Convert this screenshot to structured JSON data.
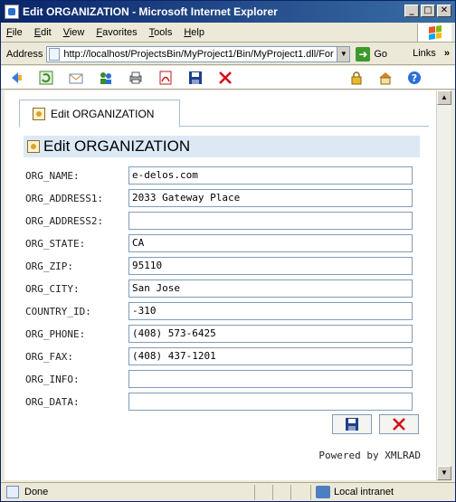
{
  "window": {
    "title": "Edit ORGANIZATION - Microsoft Internet Explorer",
    "minimize_glyph": "_",
    "maximize_glyph": "□",
    "close_glyph": "✕"
  },
  "menu": {
    "items": [
      "File",
      "Edit",
      "View",
      "Favorites",
      "Tools",
      "Help"
    ]
  },
  "address_bar": {
    "label": "Address",
    "url": "http://localhost/ProjectsBin/MyProject1/Bin/MyProject1.dll/For",
    "go_label": "Go",
    "links_label": "Links",
    "links_chevron": "»"
  },
  "toolbar": {
    "icons": [
      "nav-back-icon",
      "refresh-icon",
      "mail-icon",
      "users-icon",
      "print-icon",
      "pdf-icon",
      "save-icon",
      "delete-icon"
    ],
    "right_icons": [
      "lock-icon",
      "home-icon",
      "help-icon"
    ]
  },
  "tab": {
    "label": "Edit ORGANIZATION"
  },
  "heading": {
    "title": "Edit ORGANIZATION"
  },
  "form": {
    "fields": [
      {
        "label": "ORG_NAME:",
        "value": "e-delos.com"
      },
      {
        "label": "ORG_ADDRESS1:",
        "value": "2033 Gateway Place"
      },
      {
        "label": "ORG_ADDRESS2:",
        "value": ""
      },
      {
        "label": "ORG_STATE:",
        "value": "CA"
      },
      {
        "label": "ORG_ZIP:",
        "value": "95110"
      },
      {
        "label": "ORG_CITY:",
        "value": "San Jose"
      },
      {
        "label": "COUNTRY_ID:",
        "value": "-310"
      },
      {
        "label": "ORG_PHONE:",
        "value": "(408) 573-6425"
      },
      {
        "label": "ORG_FAX:",
        "value": "(408) 437-1201"
      },
      {
        "label": "ORG_INFO:",
        "value": ""
      },
      {
        "label": "ORG_DATA:",
        "value": ""
      }
    ]
  },
  "footer": {
    "powered_by": "Powered by XMLRAD"
  },
  "status": {
    "text": "Done",
    "zone": "Local intranet"
  },
  "colors": {
    "title_bar": "#0a246a",
    "heading_bg": "#dce9f5",
    "delete_red": "#d4111b"
  }
}
